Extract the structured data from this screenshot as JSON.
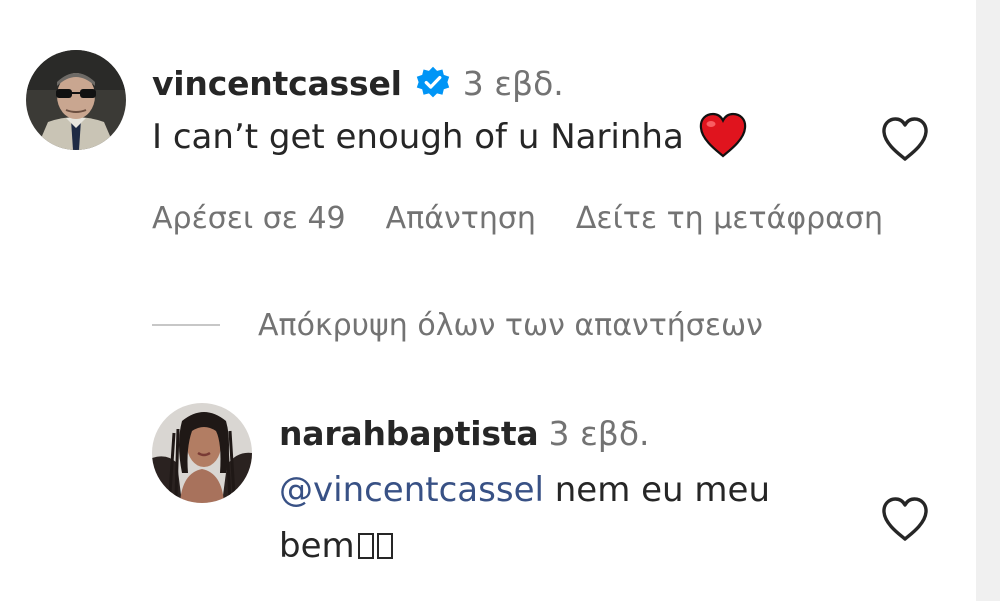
{
  "main_comment": {
    "username": "vincentcassel",
    "verified_icon": "verified-badge-icon",
    "time": "3 εβδ.",
    "text": "I can’t get enough of u Narinha",
    "emoji": "red-heart-emoji",
    "emoji_color": "#e0141e",
    "actions": {
      "likes": "Αρέσει σε 49",
      "reply": "Απάντηση",
      "translate": "Δείτε τη μετάφραση"
    },
    "hide_replies": "Απόκρυψη όλων των απαντήσεων"
  },
  "reply_comment": {
    "username": "narahbaptista",
    "time": "3 εβδ.",
    "mention": "@vincentcassel",
    "text_after_mention": " nem eu meu",
    "text_line2": "bem"
  },
  "colors": {
    "text_primary": "#262626",
    "text_secondary": "#737373",
    "mention": "#385185",
    "verified_blue": "#0095f6"
  }
}
